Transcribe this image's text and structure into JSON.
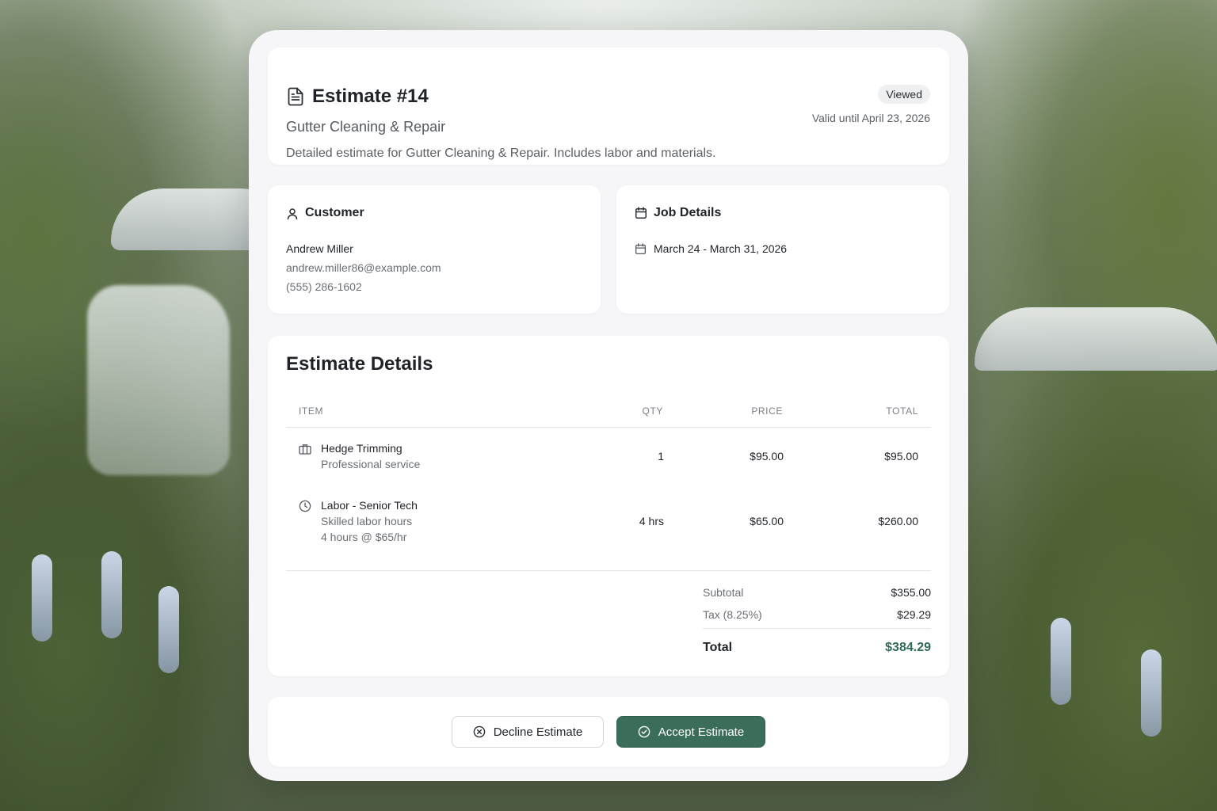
{
  "header": {
    "title": "Estimate #14",
    "subtitle": "Gutter Cleaning & Repair",
    "description": "Detailed estimate for Gutter Cleaning & Repair. Includes labor and materials.",
    "status_badge": "Viewed",
    "valid_until": "Valid until April 23, 2026",
    "icon": "document-icon"
  },
  "customer": {
    "section_title": "Customer",
    "icon": "user-icon",
    "name": "Andrew Miller",
    "email": "andrew.miller86@example.com",
    "phone": "(555) 286-1602"
  },
  "job": {
    "section_title": "Job Details",
    "icon": "calendar-icon",
    "dates": "March 24 - March 31, 2026"
  },
  "estimate": {
    "section_title": "Estimate Details",
    "columns": {
      "item": "ITEM",
      "qty": "QTY",
      "price": "PRICE",
      "total": "TOTAL"
    },
    "rows": [
      {
        "icon": "briefcase-icon",
        "name": "Hedge Trimming",
        "detail": "Professional service",
        "detail2": "",
        "qty": "1",
        "price": "$95.00",
        "total": "$95.00"
      },
      {
        "icon": "clock-icon",
        "name": "Labor - Senior Tech",
        "detail": "Skilled labor hours",
        "detail2": "4 hours @ $65/hr",
        "qty": "4 hrs",
        "price": "$65.00",
        "total": "$260.00"
      }
    ],
    "subtotal_label": "Subtotal",
    "subtotal": "$355.00",
    "tax_label": "Tax (8.25%)",
    "tax": "$29.29",
    "total_label": "Total",
    "total": "$384.29"
  },
  "actions": {
    "decline_label": "Decline Estimate",
    "decline_icon": "x-circle-icon",
    "accept_label": "Accept Estimate",
    "accept_icon": "check-circle-icon"
  },
  "colors": {
    "accent": "#3a6e5a",
    "total": "#2f6b57",
    "card_bg": "#f6f6f9"
  }
}
